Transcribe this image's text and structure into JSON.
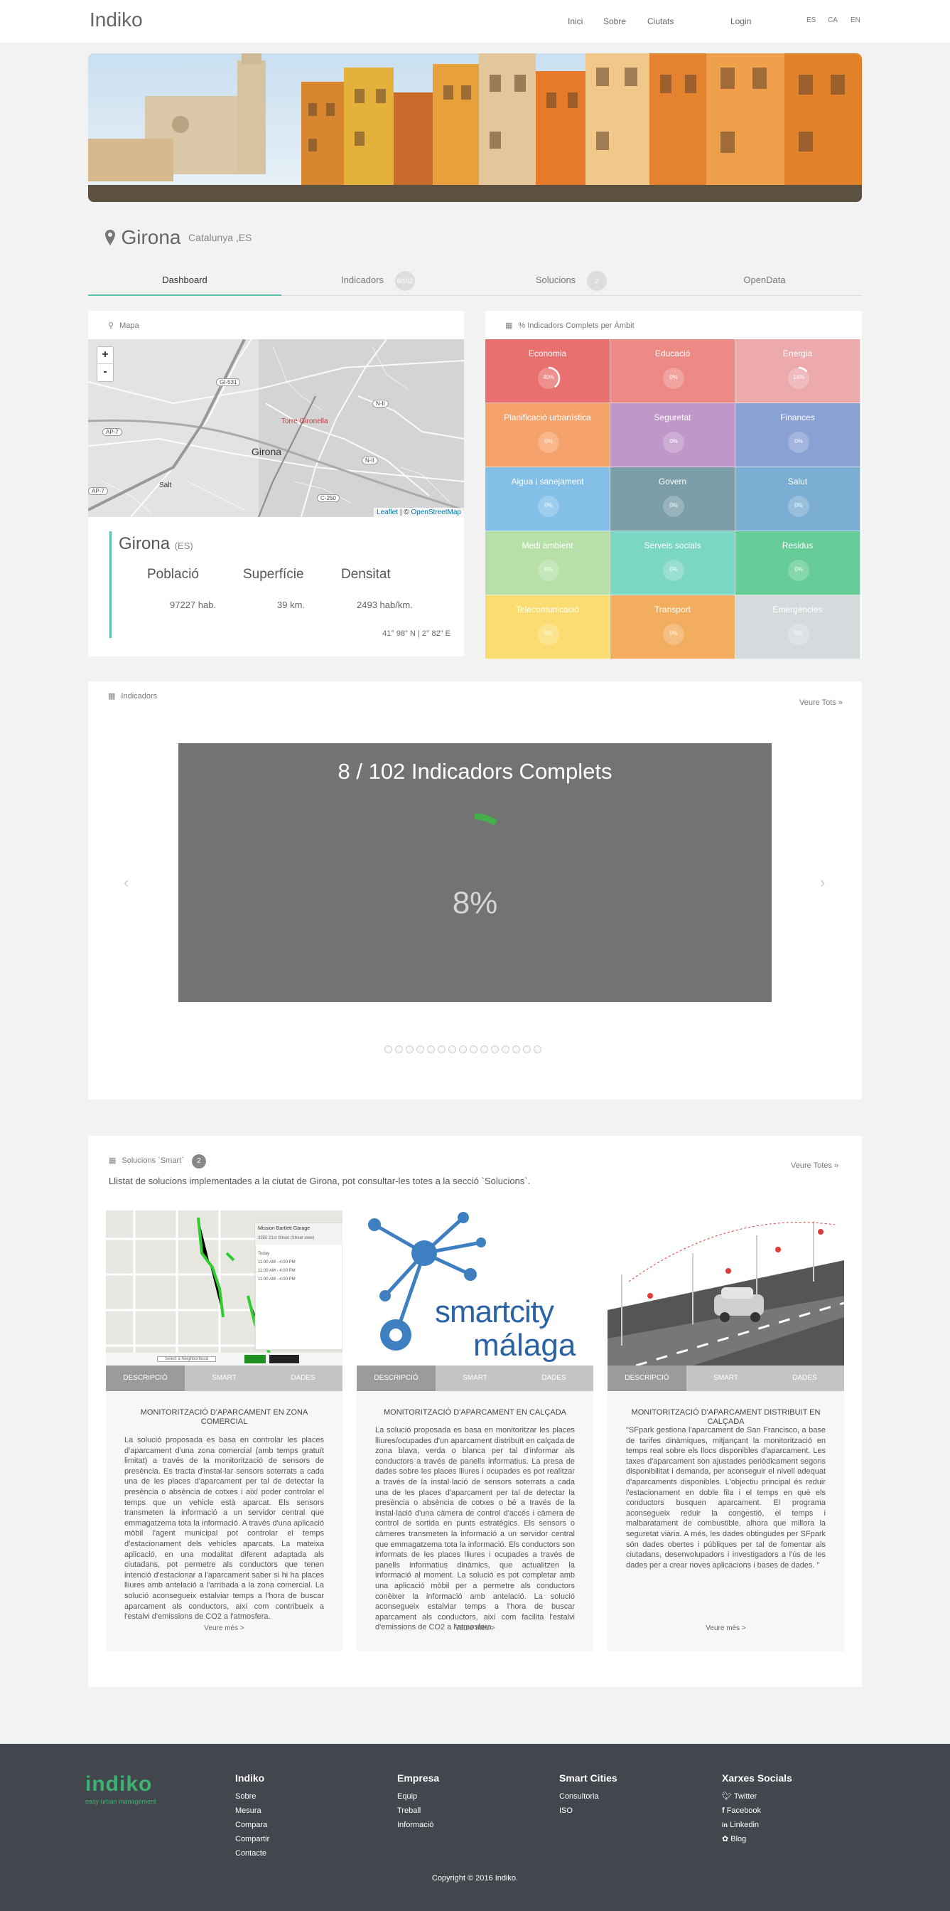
{
  "header": {
    "brand": "Indiko",
    "nav": [
      "Inici",
      "Sobre",
      "Ciutats"
    ],
    "login": "Login",
    "langs": [
      "ES",
      "CA",
      "EN"
    ]
  },
  "city": {
    "name": "Girona",
    "region": "Catalunya ,ES"
  },
  "tabs": [
    {
      "label": "Dashboard"
    },
    {
      "label": "Indicadors",
      "badge": "8/102"
    },
    {
      "label": "Solucions",
      "badge": "2"
    },
    {
      "label": "OpenData"
    }
  ],
  "map_panel": {
    "title": "Mapa",
    "zoom_in": "+",
    "zoom_out": "-",
    "labels": [
      "GI-531",
      "N-II",
      "AP-7",
      "Torre Gironella",
      "Girona",
      "N-II",
      "AP-7",
      "Salt",
      "C-250"
    ],
    "attribution_leaflet": "Leaflet",
    "attribution_sep": " | © ",
    "attribution_osm": "OpenStreetMap"
  },
  "city_info": {
    "name": "Girona",
    "country": "(ES)",
    "stats": [
      {
        "label": "Població",
        "value": "97227 hab."
      },
      {
        "label": "Superfície",
        "value": "39 km."
      },
      {
        "label": "Densitat",
        "value": "2493 hab/km."
      }
    ],
    "coords": "41° 98\" N | 2° 82\" E"
  },
  "ambits_panel": {
    "title": "% Indicadors Complets per Àmbit",
    "cells": [
      {
        "label": "Economia",
        "pct": "40%",
        "value": 40,
        "color": "#e8716f"
      },
      {
        "label": "Educació",
        "pct": "0%",
        "value": 0,
        "color": "#ee8a86"
      },
      {
        "label": "Energia",
        "pct": "14%",
        "value": 14,
        "color": "#ecaaad"
      },
      {
        "label": "Planificació urbanística",
        "pct": "0%",
        "value": 0,
        "color": "#f6a26b"
      },
      {
        "label": "Seguretat",
        "pct": "0%",
        "value": 0,
        "color": "#c097c9"
      },
      {
        "label": "Finances",
        "pct": "0%",
        "value": 0,
        "color": "#8aa1d3"
      },
      {
        "label": "Aigua i sanejament",
        "pct": "0%",
        "value": 0,
        "color": "#84bfe8"
      },
      {
        "label": "Govern",
        "pct": "0%",
        "value": 0,
        "color": "#7c9ea8"
      },
      {
        "label": "Salut",
        "pct": "0%",
        "value": 0,
        "color": "#7baed2"
      },
      {
        "label": "Medi ambient",
        "pct": "0%",
        "value": 0,
        "color": "#b7e0a9"
      },
      {
        "label": "Serveis socials",
        "pct": "0%",
        "value": 0,
        "color": "#7bd6c4"
      },
      {
        "label": "Residus",
        "pct": "0%",
        "value": 0,
        "color": "#66cc98"
      },
      {
        "label": "Telecomunicació",
        "pct": "0%",
        "value": 0,
        "color": "#fbdc70"
      },
      {
        "label": "Transport",
        "pct": "0%",
        "value": 0,
        "color": "#f3ad5e"
      },
      {
        "label": "Emergències",
        "pct": "0%",
        "value": 0,
        "color": "#d5dadd"
      }
    ]
  },
  "indicators": {
    "title": "Indicadors",
    "see_all": "Veure Tots »",
    "slide_title": "8 / 102 Indicadors Complets",
    "slide_pct": "8%",
    "progress": 8,
    "accent": "#44b04a",
    "prev": "‹",
    "next": "›",
    "dot_count": 15
  },
  "solutions": {
    "title": "Solucions `Smart`",
    "badge": "2",
    "see_all": "Veure Totes »",
    "subtitle": "Llistat de solucions implementades a la ciutat de Girona, pot consultar-les totes a la secció `Solucions`.",
    "tab_labels": [
      "DESCRIPCIÓ",
      "SMART",
      "DADES"
    ],
    "more": "Veure més >",
    "cards": [
      {
        "title": "MONITORITZACIÓ D'APARCAMENT EN ZONA COMERCIAL",
        "text": "La solució proposada es basa en controlar les places d'aparcament d'una zona comercial (amb temps gratuït limitat) a través de la monitorització de sensors de presència. Es tracta d'instal·lar sensors soterrats a cada una de les places d'aparcament per tal de detectar la presència o absència de cotxes i així poder controlar el temps que un vehicle està aparcat. Els sensors transmeten la informació a un servidor central que emmagatzema tota la informació. A través d'una aplicació mòbil l'agent municipal pot controlar el temps d'estacionament dels vehicles aparcats. La mateixa aplicació, en una modalitat diferent adaptada als ciutadans, pot permetre als conductors que tenen intenció d'estacionar a l'aparcament saber si hi ha places lliures amb antelació a l'arribada a la zona comercial. La solució aconsegueix estalviar temps a l'hora de buscar aparcament als conductors, així com contribueix a l'estalvi d'emissions de CO2 a l'atmosfera.",
        "img_label": "Mission Bartlett Garage",
        "img_sub": "Select a Neighborhood",
        "img_bubble_items": [
          "3350 21st Street (Street view)",
          "Today",
          "11:00 AM - 4:00 PM",
          "11:00 AM - 4:00 PM",
          "11:00 AM - 4:00 PM"
        ]
      },
      {
        "title": "MONITORITZACIÓ D'APARCAMENT EN CALÇADA",
        "text": "La solució proposada es basa en monitoritzar les places lliures/ocupades d'un aparcament distribuït en calçada de zona blava, verda o blanca per tal d'informar als conductors a través de panells informatius. La presa de dades sobre les places lliures i ocupades es pot realitzar a través de la instal·lació de sensors soterrats a cada una de les places d'aparcament per tal de detectar la presència o absència de cotxes o bé a través de la instal·lació d'una càmera de control d'accés i càmera de control de sortida en punts estratègics. Els sensors o càmeres transmeten la informació a un servidor central que emmagatzema tota la informació. Els conductors son informats de les places lliures i ocupades a través de panells informatius dinàmics, que actualitzen la informació al moment. La solució es pot completar amb una aplicació mòbil per a permetre als conductors conèixer la informació amb antelació. La solució aconsegueix estalviar temps a l'hora de buscar aparcament als conductors, així com facilita l'estalvi d'emissions de CO2 a l'atmosfera.",
        "img_word1": "smartcity",
        "img_word2": "málaga"
      },
      {
        "title": "MONITORITZACIÓ D'APARCAMENT DISTRIBUIT EN CALÇADA",
        "text": "\"SFpark gestiona l'aparcament de San Francisco, a base de tarifes dinàmiques, mitjançant la monitorització en temps real sobre els llocs disponibles d'aparcament. Les taxes d'aparcament son ajustades periòdicament segons disponibilitat i demanda, per aconseguir el nivell adequat d'aparcaments disponibles. L'objectiu principal és reduir l'estacionament en doble fila i el temps en què els conductors busquen aparcament. El programa aconsegueix reduir la congestió, el temps i malbaratament de combustible, alhora que millora la seguretat viària. A més, les dades obtingudes per SFpark són dades obertes i públiques per tal de fomentar als ciutadans, desenvolupadors i investigadors a l'ús de les dades per a crear noves aplicacions i bases de dades. \""
      }
    ]
  },
  "footer": {
    "logo": "indiko",
    "tagline": "easy urban management",
    "cols": [
      {
        "head": "Indiko",
        "items": [
          "Sobre",
          "Mesura",
          "Compara",
          "Compartir",
          "Contacte"
        ]
      },
      {
        "head": "Empresa",
        "items": [
          "Equip",
          "Treball",
          "Informació"
        ]
      },
      {
        "head": "Smart Cities",
        "items": [
          "Consultoria",
          "ISO"
        ]
      },
      {
        "head": "Xarxes Socials",
        "items": [
          "Twitter",
          "Facebook",
          "Linkedin",
          "Blog"
        ]
      }
    ],
    "copyright": "Copyright © 2016 Indiko."
  }
}
